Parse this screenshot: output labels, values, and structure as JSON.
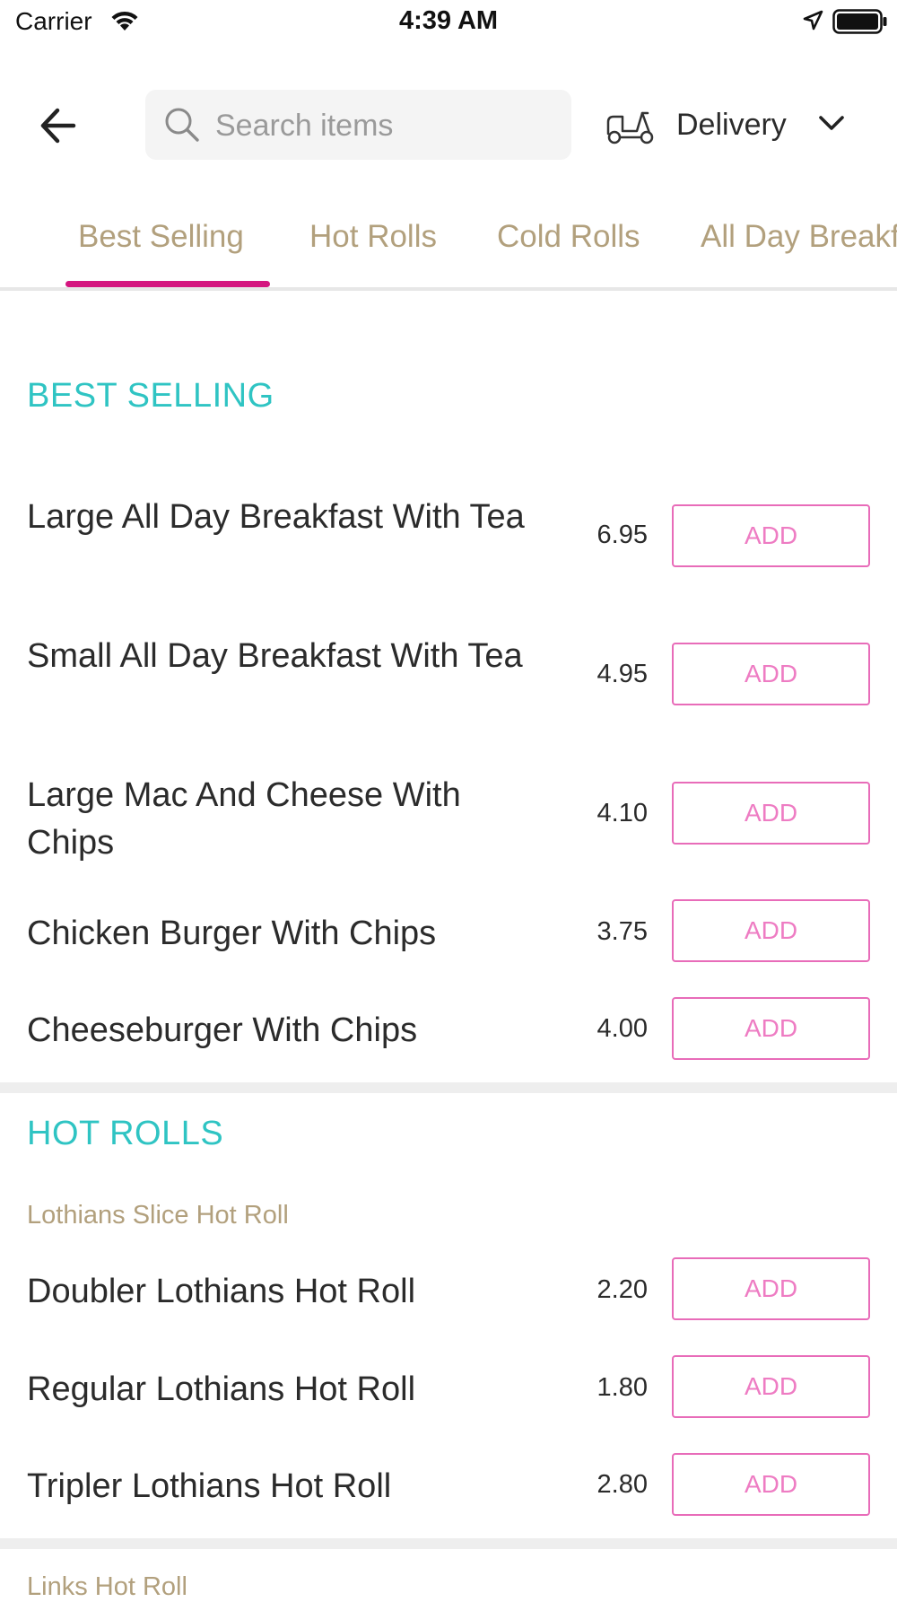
{
  "status_bar": {
    "carrier": "Carrier",
    "time": "4:39 AM"
  },
  "header": {
    "search_placeholder": "Search items",
    "delivery_label": "Delivery"
  },
  "tabs": [
    {
      "label": "Best Selling",
      "active": true
    },
    {
      "label": "Hot Rolls",
      "active": false
    },
    {
      "label": "Cold Rolls",
      "active": false
    },
    {
      "label": "All Day Breakfast",
      "active": false
    }
  ],
  "colors": {
    "accent": "#d4157f",
    "section_title": "#2fc4c3",
    "tab_text": "#b2a07d",
    "add_button": "#e86cb9"
  },
  "sections": [
    {
      "title": "BEST SELLING",
      "items": [
        {
          "name": "Large All Day Breakfast With Tea",
          "price": "6.95",
          "button": "ADD"
        },
        {
          "name": "Small All Day Breakfast With Tea",
          "price": "4.95",
          "button": "ADD"
        },
        {
          "name": "Large Mac And Cheese With Chips",
          "price": "4.10",
          "button": "ADD"
        },
        {
          "name": "Chicken Burger With Chips",
          "price": "3.75",
          "button": "ADD"
        },
        {
          "name": "Cheeseburger With Chips",
          "price": "4.00",
          "button": "ADD"
        }
      ]
    },
    {
      "title": "HOT ROLLS",
      "subsections": [
        {
          "title": "Lothians Slice Hot Roll",
          "items": [
            {
              "name": "Doubler Lothians Hot Roll",
              "price": "2.20",
              "button": "ADD"
            },
            {
              "name": "Regular Lothians Hot Roll",
              "price": "1.80",
              "button": "ADD"
            },
            {
              "name": "Tripler Lothians Hot Roll",
              "price": "2.80",
              "button": "ADD"
            }
          ]
        },
        {
          "title": "Links Hot Roll",
          "items": []
        }
      ]
    }
  ]
}
